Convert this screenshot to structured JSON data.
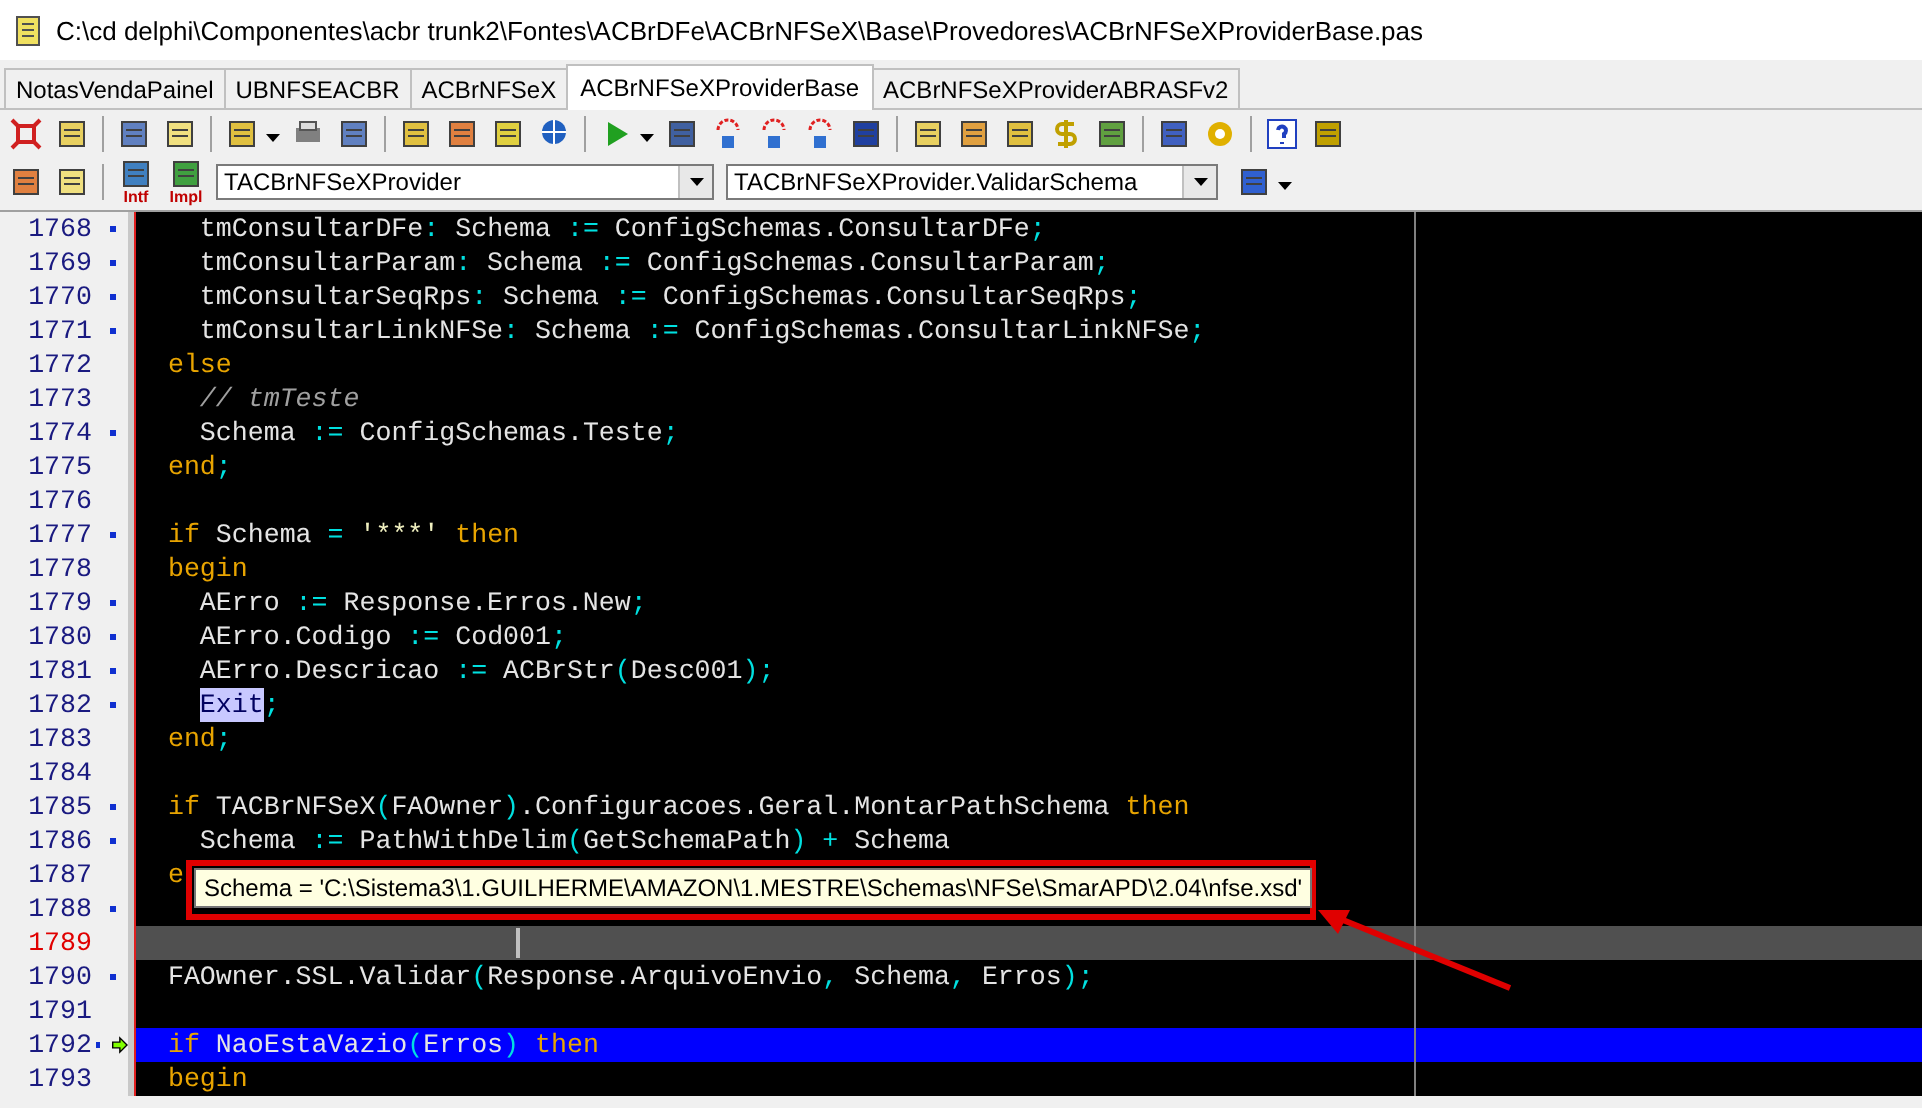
{
  "window": {
    "title": "C:\\cd delphi\\Componentes\\acbr trunk2\\Fontes\\ACBrDFe\\ACBrNFSeX\\Base\\Provedores\\ACBrNFSeXProviderBase.pas"
  },
  "tabs": [
    {
      "label": "NotasVendaPainel",
      "selected": false
    },
    {
      "label": "UBNFSEACBR",
      "selected": false
    },
    {
      "label": "ACBrNFSeX",
      "selected": false
    },
    {
      "label": "ACBrNFSeXProviderBase",
      "selected": true
    },
    {
      "label": "ACBrNFSeXProviderABRASFv2",
      "selected": false
    }
  ],
  "toolbar": {
    "interface_label": "Intf",
    "implementation_label": "Impl",
    "class_combo": "TACBrNFSeXProvider",
    "method_combo": "TACBrNFSeXProvider.ValidarSchema"
  },
  "editor": {
    "lines": [
      {
        "number": "1768",
        "dot": true,
        "marked": false,
        "executing": false,
        "tokens": [
          {
            "kind": "id",
            "text": "    tmConsultarDFe"
          },
          {
            "kind": "sym",
            "text": ":"
          },
          {
            "kind": "id",
            "text": " Schema "
          },
          {
            "kind": "sym",
            "text": ":="
          },
          {
            "kind": "id",
            "text": " ConfigSchemas.ConsultarDFe"
          },
          {
            "kind": "sym",
            "text": ";"
          }
        ]
      },
      {
        "number": "1769",
        "dot": true,
        "marked": false,
        "executing": false,
        "tokens": [
          {
            "kind": "id",
            "text": "    tmConsultarParam"
          },
          {
            "kind": "sym",
            "text": ":"
          },
          {
            "kind": "id",
            "text": " Schema "
          },
          {
            "kind": "sym",
            "text": ":="
          },
          {
            "kind": "id",
            "text": " ConfigSchemas.ConsultarParam"
          },
          {
            "kind": "sym",
            "text": ";"
          }
        ]
      },
      {
        "number": "1770",
        "dot": true,
        "marked": false,
        "executing": false,
        "tokens": [
          {
            "kind": "id",
            "text": "    tmConsultarSeqRps"
          },
          {
            "kind": "sym",
            "text": ":"
          },
          {
            "kind": "id",
            "text": " Schema "
          },
          {
            "kind": "sym",
            "text": ":="
          },
          {
            "kind": "id",
            "text": " ConfigSchemas.ConsultarSeqRps"
          },
          {
            "kind": "sym",
            "text": ";"
          }
        ]
      },
      {
        "number": "1771",
        "dot": true,
        "marked": false,
        "executing": false,
        "tokens": [
          {
            "kind": "id",
            "text": "    tmConsultarLinkNFSe"
          },
          {
            "kind": "sym",
            "text": ":"
          },
          {
            "kind": "id",
            "text": " Schema "
          },
          {
            "kind": "sym",
            "text": ":="
          },
          {
            "kind": "id",
            "text": " ConfigSchemas.ConsultarLinkNFSe"
          },
          {
            "kind": "sym",
            "text": ";"
          }
        ]
      },
      {
        "number": "1772",
        "dot": false,
        "marked": false,
        "executing": false,
        "tokens": [
          {
            "kind": "kw",
            "text": "  else"
          }
        ]
      },
      {
        "number": "1773",
        "dot": false,
        "marked": false,
        "executing": false,
        "tokens": [
          {
            "kind": "cm",
            "text": "    // tmTeste"
          }
        ]
      },
      {
        "number": "1774",
        "dot": true,
        "marked": false,
        "executing": false,
        "tokens": [
          {
            "kind": "id",
            "text": "    Schema "
          },
          {
            "kind": "sym",
            "text": ":="
          },
          {
            "kind": "id",
            "text": " ConfigSchemas.Teste"
          },
          {
            "kind": "sym",
            "text": ";"
          }
        ]
      },
      {
        "number": "1775",
        "dot": false,
        "marked": false,
        "executing": false,
        "tokens": [
          {
            "kind": "kw",
            "text": "  end"
          },
          {
            "kind": "sym",
            "text": ";"
          }
        ]
      },
      {
        "number": "1776",
        "dot": false,
        "marked": false,
        "executing": false
      },
      {
        "number": "1777",
        "dot": true,
        "marked": false,
        "executing": false,
        "tokens": [
          {
            "kind": "kw",
            "text": "  if"
          },
          {
            "kind": "id",
            "text": " Schema "
          },
          {
            "kind": "sym",
            "text": "="
          },
          {
            "kind": "str",
            "text": " '***' "
          },
          {
            "kind": "kw",
            "text": "then"
          }
        ]
      },
      {
        "number": "1778",
        "dot": false,
        "marked": false,
        "executing": false,
        "tokens": [
          {
            "kind": "kw",
            "text": "  begin"
          }
        ]
      },
      {
        "number": "1779",
        "dot": true,
        "marked": false,
        "executing": false,
        "tokens": [
          {
            "kind": "id",
            "text": "    AErro "
          },
          {
            "kind": "sym",
            "text": ":="
          },
          {
            "kind": "id",
            "text": " Response.Erros.New"
          },
          {
            "kind": "sym",
            "text": ";"
          }
        ]
      },
      {
        "number": "1780",
        "dot": true,
        "marked": false,
        "executing": false,
        "tokens": [
          {
            "kind": "id",
            "text": "    AErro.Codigo "
          },
          {
            "kind": "sym",
            "text": ":="
          },
          {
            "kind": "id",
            "text": " Cod001"
          },
          {
            "kind": "sym",
            "text": ";"
          }
        ]
      },
      {
        "number": "1781",
        "dot": true,
        "marked": false,
        "executing": false,
        "tokens": [
          {
            "kind": "id",
            "text": "    AErro.Descricao "
          },
          {
            "kind": "sym",
            "text": ":="
          },
          {
            "kind": "id",
            "text": " ACBrStr"
          },
          {
            "kind": "sym",
            "text": "("
          },
          {
            "kind": "id",
            "text": "Desc001"
          },
          {
            "kind": "sym",
            "text": ");"
          }
        ]
      },
      {
        "number": "1782",
        "dot": true,
        "marked": false,
        "executing": false,
        "tokens": [
          {
            "kind": "hl",
            "text": "    Exit"
          },
          {
            "kind": "sym",
            "text": ";"
          }
        ]
      },
      {
        "number": "1783",
        "dot": false,
        "marked": false,
        "executing": false,
        "tokens": [
          {
            "kind": "kw",
            "text": "  end"
          },
          {
            "kind": "sym",
            "text": ";"
          }
        ]
      },
      {
        "number": "1784",
        "dot": false,
        "marked": false,
        "executing": false
      },
      {
        "number": "1785",
        "dot": true,
        "marked": false,
        "executing": false,
        "tokens": [
          {
            "kind": "kw",
            "text": "  if"
          },
          {
            "kind": "id",
            "text": " TACBrNFSeX"
          },
          {
            "kind": "sym",
            "text": "("
          },
          {
            "kind": "id",
            "text": "FAOwner"
          },
          {
            "kind": "sym",
            "text": ")"
          },
          {
            "kind": "id",
            "text": ".Configuracoes.Geral.MontarPathSchema "
          },
          {
            "kind": "kw",
            "text": "then"
          }
        ]
      },
      {
        "number": "1786",
        "dot": true,
        "marked": false,
        "executing": false,
        "tokens": [
          {
            "kind": "id",
            "text": "    Schema "
          },
          {
            "kind": "sym",
            "text": ":="
          },
          {
            "kind": "id",
            "text": " PathWithDelim"
          },
          {
            "kind": "sym",
            "text": "("
          },
          {
            "kind": "id",
            "text": "GetSchemaPath"
          },
          {
            "kind": "sym",
            "text": ") +"
          },
          {
            "kind": "id",
            "text": " Schema"
          }
        ]
      },
      {
        "number": "1787",
        "dot": false,
        "marked": false,
        "executing": false,
        "tokens": [
          {
            "kind": "kw",
            "text": "  e"
          }
        ]
      },
      {
        "number": "1788",
        "dot": true,
        "marked": false,
        "executing": false
      },
      {
        "number": "1789",
        "dot": false,
        "marked": true,
        "executing": false
      },
      {
        "number": "1790",
        "dot": true,
        "marked": false,
        "executing": false,
        "tokens": [
          {
            "kind": "id",
            "text": "  FAOwner.SSL.Validar"
          },
          {
            "kind": "sym",
            "text": "("
          },
          {
            "kind": "id",
            "text": "Response.ArquivoEnvio"
          },
          {
            "kind": "sym",
            "text": ","
          },
          {
            "kind": "id",
            "text": " Schema"
          },
          {
            "kind": "sym",
            "text": ","
          },
          {
            "kind": "id",
            "text": " Erros"
          },
          {
            "kind": "sym",
            "text": ");"
          }
        ]
      },
      {
        "number": "1791",
        "dot": false,
        "marked": false,
        "executing": false
      },
      {
        "number": "1792",
        "dot": true,
        "marked": false,
        "executing": true,
        "tokens": [
          {
            "kind": "kw",
            "text": "  if"
          },
          {
            "kind": "id",
            "text": " NaoEstaVazio"
          },
          {
            "kind": "sym",
            "text": "("
          },
          {
            "kind": "id",
            "text": "Erros"
          },
          {
            "kind": "sym",
            "text": ")"
          },
          {
            "kind": "kw",
            "text": " then"
          }
        ]
      },
      {
        "number": "1793",
        "dot": false,
        "marked": false,
        "executing": false,
        "tokens": [
          {
            "kind": "kw",
            "text": "  begin"
          }
        ]
      }
    ]
  },
  "tooltip": {
    "text": "Schema = 'C:\\Sistema3\\1.GUILHERME\\AMAZON\\1.MESTRE\\Schemas\\NFSe\\SmarAPD\\2.04\\nfse.xsd'"
  }
}
